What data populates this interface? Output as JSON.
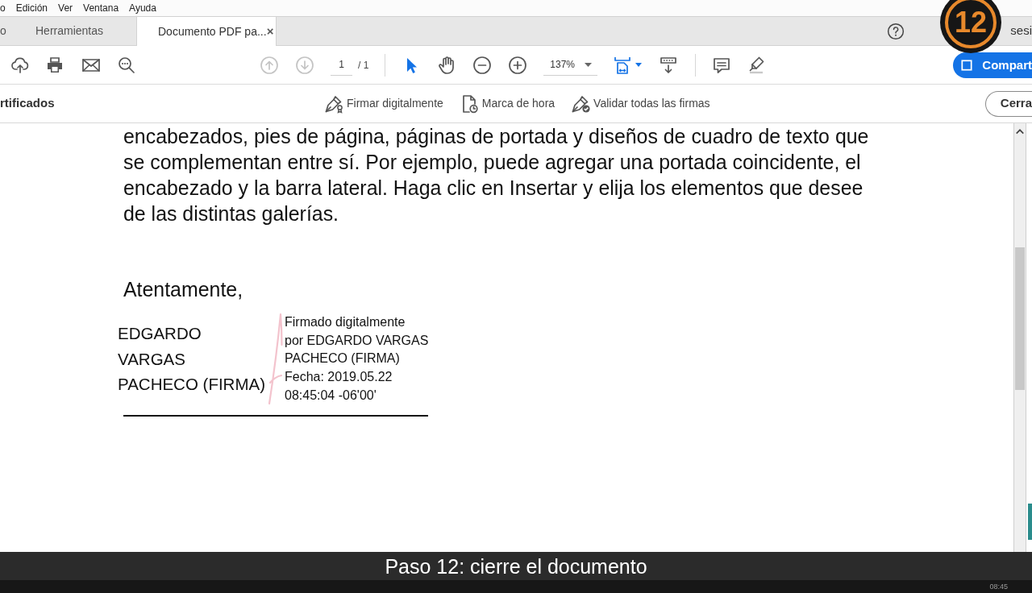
{
  "menu_bar": {
    "items": [
      "o",
      "Edición",
      "Ver",
      "Ventana",
      "Ayuda"
    ]
  },
  "tabs": [
    {
      "label": "o",
      "selected": false
    },
    {
      "label": "Herramientas",
      "selected": false
    },
    {
      "label": "Documento PDF pa...",
      "selected": true,
      "close": "×"
    }
  ],
  "header": {
    "account_label": "sesi",
    "step_badge": "12"
  },
  "toolbar": {
    "prev_page": {
      "disabled": true
    },
    "next_page": {
      "disabled": true
    },
    "page_current": "1",
    "page_total": "/ 1",
    "tools": [
      {
        "kind": "select",
        "selected": true
      },
      {
        "kind": "hand",
        "selected": false
      }
    ],
    "zoom": "137%",
    "share_button": "Compart"
  },
  "tool_panel": {
    "title": "rtificados",
    "actions": [
      {
        "kind": "sign",
        "label": "Firmar digitalmente"
      },
      {
        "kind": "timestamp",
        "label": "Marca de hora"
      },
      {
        "kind": "validate",
        "label": "Validar todas las firmas"
      }
    ],
    "close_button": "Cerra"
  },
  "document": {
    "paragraph": "encabezados, pies de página, páginas de portada y diseños de cuadro de texto que\nse complementan entre sí. Por ejemplo, puede agregar una portada coincidente, el\nencabezado y la barra lateral. Haga clic en Insertar y elija los elementos que desee\nde las distintas galerías.",
    "closing": "Atentamente,",
    "signature": {
      "name": "EDGARDO\nVARGAS\nPACHECO (FIRMA)",
      "details": "Firmado digitalmente\npor EDGARDO VARGAS\nPACHECO (FIRMA)\nFecha: 2019.05.22\n08:45:04 -06'00'"
    }
  },
  "caption": "Paso 12: cierre el documento",
  "taskbar": {
    "clock": "08:45"
  }
}
